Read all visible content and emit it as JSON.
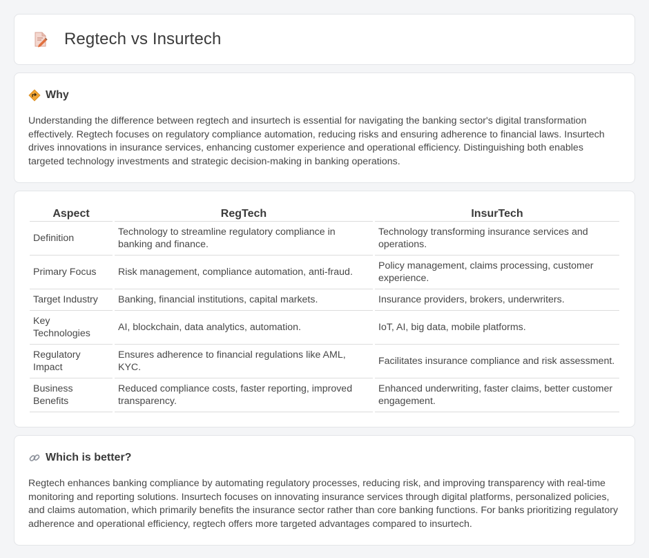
{
  "header": {
    "title": "Regtech vs Insurtech",
    "icon": "document-pencil-icon"
  },
  "why": {
    "icon": "road-sign-icon",
    "title": "Why",
    "text": "Understanding the difference between regtech and insurtech is essential for navigating the banking sector's digital transformation effectively. Regtech focuses on regulatory compliance automation, reducing risks and ensuring adherence to financial laws. Insurtech drives innovations in insurance services, enhancing customer experience and operational efficiency. Distinguishing both enables targeted technology investments and strategic decision-making in banking operations."
  },
  "table": {
    "headers": [
      "Aspect",
      "RegTech",
      "InsurTech"
    ],
    "rows": [
      [
        "Definition",
        "Technology to streamline regulatory compliance in banking and finance.",
        "Technology transforming insurance services and operations."
      ],
      [
        "Primary Focus",
        "Risk management, compliance automation, anti-fraud.",
        "Policy management, claims processing, customer experience."
      ],
      [
        "Target Industry",
        "Banking, financial institutions, capital markets.",
        "Insurance providers, brokers, underwriters."
      ],
      [
        "Key Technologies",
        "AI, blockchain, data analytics, automation.",
        "IoT, AI, big data, mobile platforms."
      ],
      [
        "Regulatory Impact",
        "Ensures adherence to financial regulations like AML, KYC.",
        "Facilitates insurance compliance and risk assessment."
      ],
      [
        "Business Benefits",
        "Reduced compliance costs, faster reporting, improved transparency.",
        "Enhanced underwriting, faster claims, better customer engagement."
      ]
    ]
  },
  "better": {
    "icon": "link-icon",
    "title": "Which is better?",
    "text": "Regtech enhances banking compliance by automating regulatory processes, reducing risk, and improving transparency with real-time monitoring and reporting solutions. Insurtech focuses on innovating insurance services through digital platforms, personalized policies, and claims automation, which primarily benefits the insurance sector rather than core banking functions. For banks prioritizing regulatory adherence and operational efficiency, regtech offers more targeted advantages compared to insurtech."
  }
}
